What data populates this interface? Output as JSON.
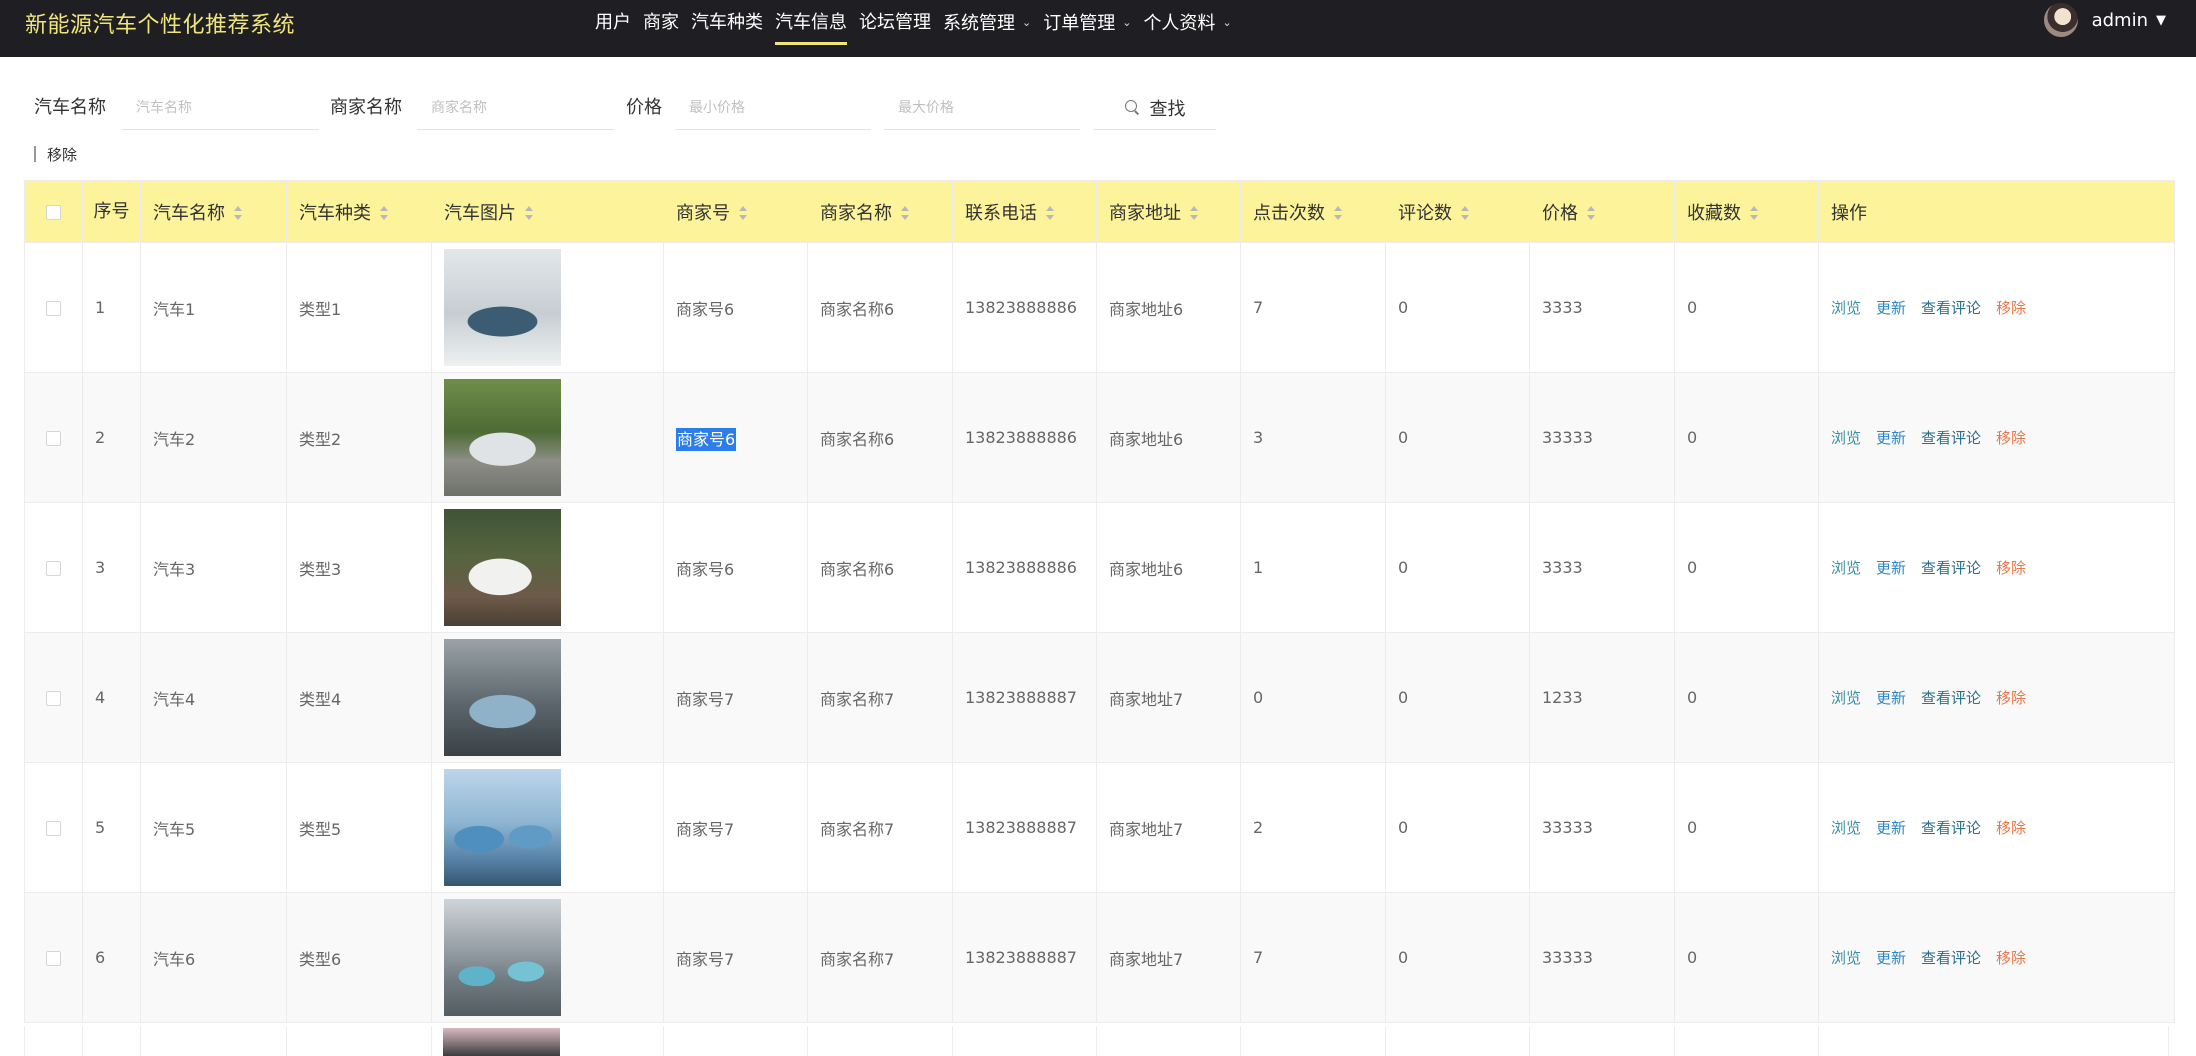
{
  "app": {
    "title": "新能源汽车个性化推荐系统"
  },
  "nav": [
    {
      "label": "用户",
      "dropdown": false,
      "active": false
    },
    {
      "label": "商家",
      "dropdown": false,
      "active": false
    },
    {
      "label": "汽车种类",
      "dropdown": false,
      "active": false
    },
    {
      "label": "汽车信息",
      "dropdown": false,
      "active": true
    },
    {
      "label": "论坛管理",
      "dropdown": false,
      "active": false
    },
    {
      "label": "系统管理",
      "dropdown": true,
      "active": false
    },
    {
      "label": "订单管理",
      "dropdown": true,
      "active": false
    },
    {
      "label": "个人资料",
      "dropdown": true,
      "active": false
    }
  ],
  "user": {
    "name": "admin"
  },
  "search": {
    "car_name_label": "汽车名称",
    "car_name_placeholder": "汽车名称",
    "merchant_name_label": "商家名称",
    "merchant_name_placeholder": "商家名称",
    "price_label": "价格",
    "price_min_placeholder": "最小价格",
    "price_max_placeholder": "最大价格",
    "button_label": "查找"
  },
  "bulk": {
    "remove_label": "移除"
  },
  "table": {
    "headers": {
      "index": "序号",
      "name": "汽车名称",
      "type": "汽车种类",
      "image": "汽车图片",
      "merchant_no": "商家号",
      "merchant_name": "商家名称",
      "phone": "联系电话",
      "address": "商家地址",
      "clicks": "点击次数",
      "comments": "评论数",
      "price": "价格",
      "favorites": "收藏数",
      "ops": "操作"
    },
    "ops": {
      "view": "浏览",
      "update": "更新",
      "comments": "查看评论",
      "remove": "移除"
    },
    "rows": [
      {
        "index": "1",
        "name": "汽车1",
        "type": "类型1",
        "merchant_no": "商家号6",
        "merchant_name": "商家名称6",
        "phone": "13823888886",
        "address": "商家地址6",
        "clicks": "7",
        "comments": "0",
        "price": "3333",
        "favorites": "0"
      },
      {
        "index": "2",
        "name": "汽车2",
        "type": "类型2",
        "merchant_no": "商家号6",
        "merchant_name": "商家名称6",
        "phone": "13823888886",
        "address": "商家地址6",
        "clicks": "3",
        "comments": "0",
        "price": "33333",
        "favorites": "0"
      },
      {
        "index": "3",
        "name": "汽车3",
        "type": "类型3",
        "merchant_no": "商家号6",
        "merchant_name": "商家名称6",
        "phone": "13823888886",
        "address": "商家地址6",
        "clicks": "1",
        "comments": "0",
        "price": "3333",
        "favorites": "0"
      },
      {
        "index": "4",
        "name": "汽车4",
        "type": "类型4",
        "merchant_no": "商家号7",
        "merchant_name": "商家名称7",
        "phone": "13823888887",
        "address": "商家地址7",
        "clicks": "0",
        "comments": "0",
        "price": "1233",
        "favorites": "0"
      },
      {
        "index": "5",
        "name": "汽车5",
        "type": "类型5",
        "merchant_no": "商家号7",
        "merchant_name": "商家名称7",
        "phone": "13823888887",
        "address": "商家地址7",
        "clicks": "2",
        "comments": "0",
        "price": "33333",
        "favorites": "0"
      },
      {
        "index": "6",
        "name": "汽车6",
        "type": "类型6",
        "merchant_no": "商家号7",
        "merchant_name": "商家名称7",
        "phone": "13823888887",
        "address": "商家地址7",
        "clicks": "7",
        "comments": "0",
        "price": "33333",
        "favorites": "0"
      }
    ]
  },
  "colors": {
    "topbar": "#1f1f23",
    "brand": "#f0e57a",
    "header_bg": "#fcf39b",
    "link_view": "#3a8fa6",
    "link_update": "#2f86c9",
    "link_comments": "#2c6f88",
    "link_remove": "#e8784b",
    "selection": "#2b7de9"
  }
}
